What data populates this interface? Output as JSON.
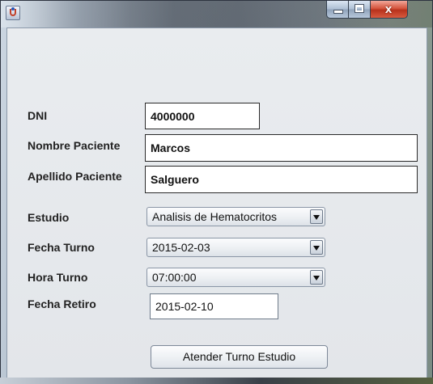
{
  "window": {
    "title": "",
    "controls": {
      "minimize": "minimize",
      "maximize": "maximize",
      "close": "x"
    }
  },
  "form": {
    "dni": {
      "label": "DNI",
      "value": "4000000"
    },
    "nombre": {
      "label": "Nombre Paciente",
      "value": "Marcos"
    },
    "apellido": {
      "label": "Apellido Paciente",
      "value": "Salguero"
    },
    "estudio": {
      "label": "Estudio",
      "selected": "Analisis de Hematocritos"
    },
    "fecha_turno": {
      "label": "Fecha Turno",
      "selected": "2015-02-03"
    },
    "hora_turno": {
      "label": "Hora Turno",
      "selected": "07:00:00"
    },
    "fecha_retiro": {
      "label": "Fecha Retiro",
      "value": "2015-02-10"
    },
    "submit_label": "Atender Turno Estudio"
  },
  "icons": {
    "app": "java-app-icon",
    "dropdown": "chevron-down-icon"
  },
  "colors": {
    "close_button": "#d4543c",
    "pane_background": "#e6e9ec"
  }
}
